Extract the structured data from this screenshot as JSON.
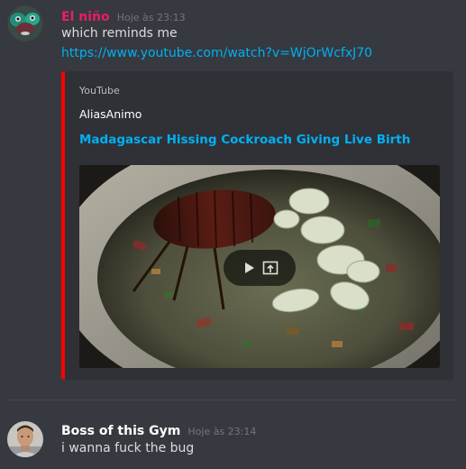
{
  "messages": [
    {
      "username": "El niño",
      "username_color": "#e91e63",
      "timestamp": "Hoje às 23:13",
      "text": "which reminds me",
      "link": "https://www.youtube.com/watch?v=WjOrWcfxJ70",
      "embed": {
        "provider": "YouTube",
        "author": "AliasAnimo",
        "title": "Madagascar Hissing Cockroach Giving Live Birth",
        "accent_color": "#ff0000",
        "controls": [
          "play-icon",
          "open-external-icon"
        ]
      }
    },
    {
      "username": "Boss of this Gym",
      "username_color": "#ffffff",
      "timestamp": "Hoje às 23:14",
      "text": "i wanna fuck the bug"
    }
  ]
}
